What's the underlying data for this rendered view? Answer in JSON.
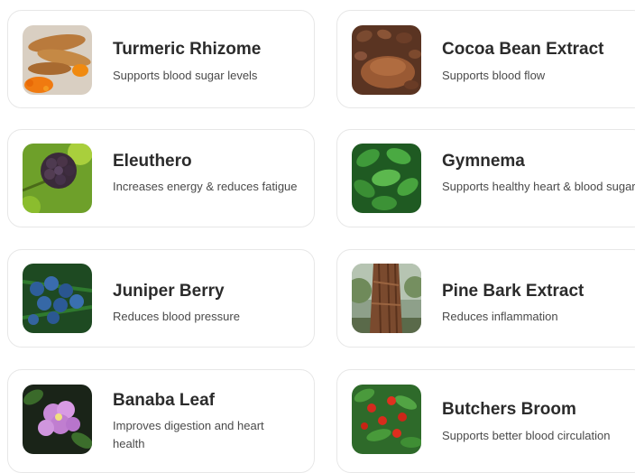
{
  "ingredients": [
    {
      "name": "Turmeric Rhizome",
      "benefit": "Supports blood sugar levels",
      "icon": "turmeric-root-image"
    },
    {
      "name": "Cocoa Bean Extract",
      "benefit": "Supports blood flow",
      "icon": "cocoa-beans-image"
    },
    {
      "name": "Eleuthero",
      "benefit": "Increases energy & reduces fatigue",
      "icon": "eleuthero-berries-image"
    },
    {
      "name": "Gymnema",
      "benefit": "Supports healthy heart & blood sugar",
      "icon": "gymnema-leaves-image"
    },
    {
      "name": "Juniper Berry",
      "benefit": "Reduces blood pressure",
      "icon": "juniper-berries-image"
    },
    {
      "name": "Pine Bark Extract",
      "benefit": "Reduces inflammation",
      "icon": "pine-bark-image"
    },
    {
      "name": "Banaba Leaf",
      "benefit": "Improves digestion and heart health",
      "icon": "banaba-flower-image"
    },
    {
      "name": "Butchers Broom",
      "benefit": "Supports better blood circulation",
      "icon": "butchers-broom-image"
    }
  ],
  "colors": {
    "card_border": "#e7e7e7",
    "title": "#2b2b2b",
    "description": "#4a4a4a"
  }
}
